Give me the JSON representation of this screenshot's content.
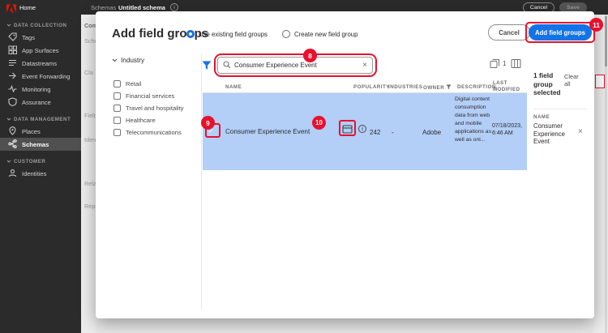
{
  "colors": {
    "accent_blue": "#1473e6",
    "annotation_red": "#e8112d",
    "selected_row_blue": "#b3cef7",
    "adobe_red": "#eb1000"
  },
  "topbar": {
    "home": "Home",
    "breadcrumb_section": "Schemas",
    "breadcrumb_page": "Untitled schema",
    "cancel": "Cancel",
    "save": "Save"
  },
  "sidebar": {
    "sections": [
      {
        "label": "DATA COLLECTION",
        "items": [
          "Tags",
          "App Surfaces",
          "Datastreams",
          "Event Forwarding",
          "Monitoring",
          "Assurance"
        ]
      },
      {
        "label": "DATA MANAGEMENT",
        "items": [
          "Places",
          "Schemas"
        ]
      },
      {
        "label": "CUSTOMER",
        "items": [
          "Identities"
        ]
      }
    ]
  },
  "background": {
    "partial_labels": [
      "Com",
      "Sche",
      "Cla",
      "Field",
      "Ident",
      "Relat",
      "Repr"
    ]
  },
  "modal": {
    "title": "Add field groups",
    "radios": {
      "existing": "Use existing field groups",
      "create_new": "Create new field group"
    },
    "buttons": {
      "cancel": "Cancel",
      "add": "Add field groups"
    },
    "filters": {
      "group": "Industry",
      "options": [
        "Retail",
        "Financial services",
        "Travel and hospitality",
        "Healthcare",
        "Telecommunications"
      ]
    },
    "search": {
      "value": "Consumer Experience Event"
    },
    "toolbar": {
      "count": "1"
    },
    "table": {
      "headers": {
        "name": "NAME",
        "popularity": "POPULARITY",
        "industries": "INDUSTRIES",
        "owner": "OWNER",
        "description": "DESCRIPTION",
        "last_modified": "LAST MODIFIED"
      },
      "row": {
        "name": "Consumer Experience Event",
        "popularity": "242",
        "industries": "-",
        "owner": "Adobe",
        "description": "Digital content consumption data from web and mobile applications as well as onl...",
        "last_modified": "07/18/2023, 6:46 AM"
      }
    },
    "summary": {
      "title": "1 field group selected",
      "clear_all": "Clear all",
      "name_label": "NAME",
      "item": "Consumer Experience Event"
    }
  },
  "annotations": {
    "badge_8": "8",
    "badge_9": "9",
    "badge_10": "10",
    "badge_11": "11"
  }
}
